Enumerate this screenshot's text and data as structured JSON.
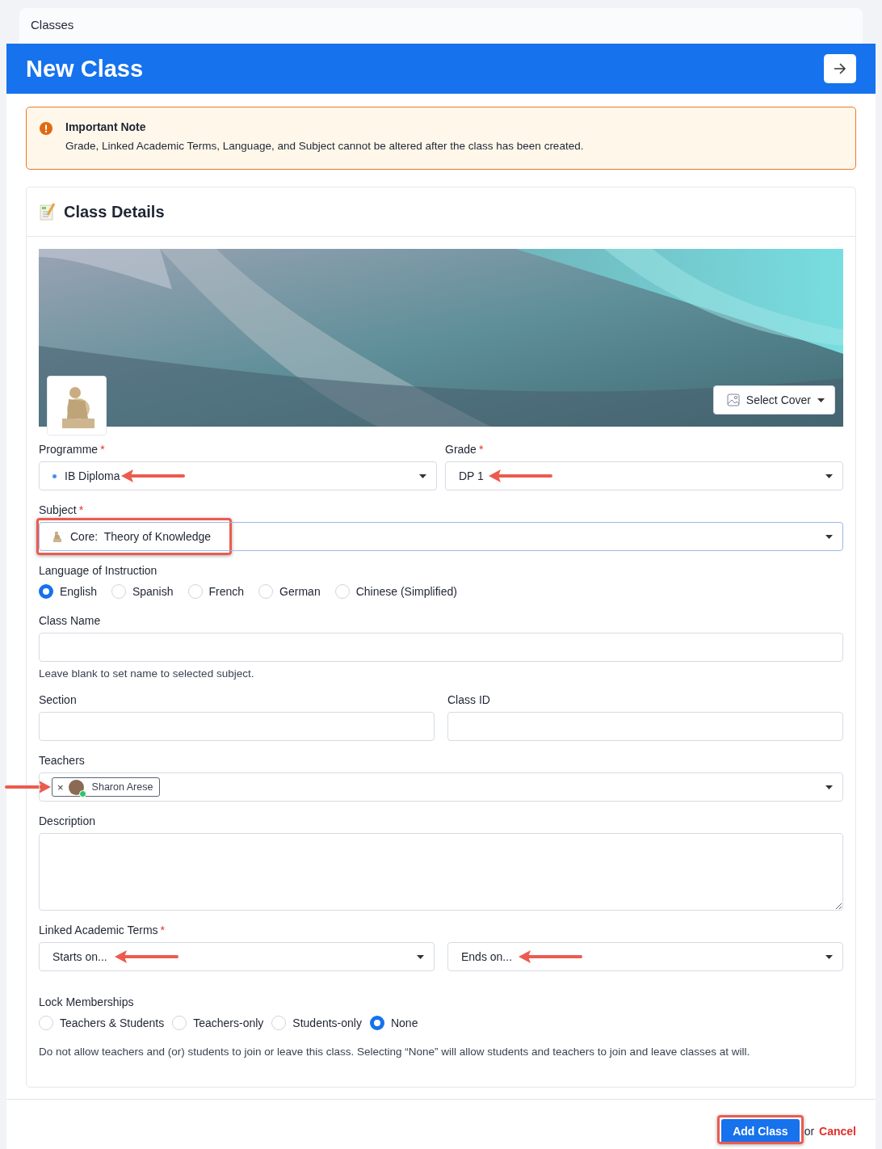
{
  "breadcrumb": "Classes",
  "header": {
    "title": "New Class"
  },
  "note": {
    "title": "Important Note",
    "text": "Grade, Linked Academic Terms, Language, and Subject cannot be altered after the class has been created."
  },
  "card": {
    "title": "Class Details"
  },
  "cover": {
    "kind": "picture",
    "button": "Select Cover"
  },
  "programme": {
    "label": "Programme",
    "required_mark": "*",
    "value": "IB Diploma"
  },
  "grade": {
    "label": "Grade",
    "required_mark": "*",
    "value": "DP 1"
  },
  "subject": {
    "label": "Subject",
    "required_mark": "*",
    "prefix": "Core:",
    "value": "Theory of Knowledge"
  },
  "language": {
    "label": "Language of Instruction",
    "options": [
      {
        "label": "English",
        "selected": true
      },
      {
        "label": "Spanish",
        "selected": false
      },
      {
        "label": "French",
        "selected": false
      },
      {
        "label": "German",
        "selected": false
      },
      {
        "label": "Chinese (Simplified)",
        "selected": false
      }
    ]
  },
  "class_name": {
    "label": "Class Name",
    "help": "Leave blank to set name to selected subject."
  },
  "section": {
    "label": "Section"
  },
  "class_id": {
    "label": "Class ID"
  },
  "teachers": {
    "label": "Teachers",
    "chips": [
      {
        "remove": "×",
        "name": "Sharon Arese",
        "online": true
      }
    ]
  },
  "description": {
    "label": "Description"
  },
  "terms": {
    "label": "Linked Academic Terms",
    "required_mark": "*",
    "start": {
      "placeholder": "Starts on..."
    },
    "end": {
      "placeholder": "Ends on..."
    }
  },
  "lock": {
    "label": "Lock Memberships",
    "options": [
      {
        "label": "Teachers & Students",
        "selected": false
      },
      {
        "label": "Teachers-only",
        "selected": false
      },
      {
        "label": "Students-only",
        "selected": false
      },
      {
        "label": "None",
        "selected": true
      }
    ],
    "help": "Do not allow teachers and (or) students to join or leave this class. Selecting “None” will allow students and teachers to join and leave classes at will."
  },
  "footer": {
    "submit": "Add Class",
    "or": "or",
    "cancel": "Cancel"
  }
}
